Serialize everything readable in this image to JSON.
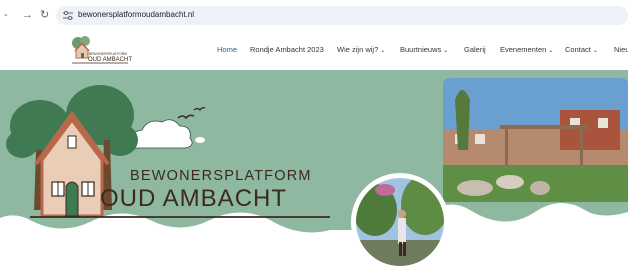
{
  "browser": {
    "back_icon": "back-arrow-icon",
    "forward_icon": "forward-arrow-icon",
    "reload_icon": "reload-icon",
    "url": "bewonersplatformoudambacht.nl"
  },
  "nav": {
    "items": [
      {
        "label": "Home",
        "active": true,
        "dropdown": false
      },
      {
        "label": "Rondje Ambacht 2023",
        "active": false,
        "dropdown": false
      },
      {
        "label": "Wie zijn wij?",
        "active": false,
        "dropdown": true
      },
      {
        "label": "Buurtnieuws",
        "active": false,
        "dropdown": true
      },
      {
        "label": "Galerij",
        "active": false,
        "dropdown": false
      },
      {
        "label": "Evenementen",
        "active": false,
        "dropdown": true
      },
      {
        "label": "Contact",
        "active": false,
        "dropdown": true
      },
      {
        "label": "Nieu",
        "active": false,
        "dropdown": false
      }
    ]
  },
  "hero": {
    "brand_line1": "BEWONERSPLATFORM",
    "brand_line2": "OUD AMBACHT",
    "bg_color": "#8fb8a0"
  },
  "colors": {
    "active_link": "#2a5d9f",
    "brand_brown": "#3b2a1f",
    "hero_green": "#8fb8a0"
  }
}
